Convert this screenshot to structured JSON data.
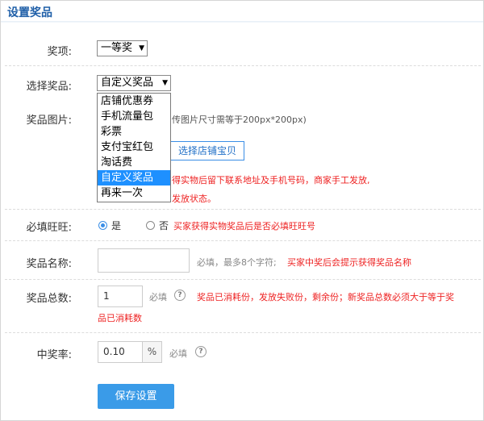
{
  "header": {
    "title": "设置奖品"
  },
  "prize_level": {
    "label": "奖项:",
    "value": "一等奖"
  },
  "prize_type": {
    "label": "选择奖品:",
    "value": "自定义奖品",
    "options": [
      "店铺优惠券",
      "手机流量包",
      "彩票",
      "支付宝红包",
      "淘话费",
      "自定义奖品",
      "再来一次"
    ],
    "selected_index": 5
  },
  "prize_image": {
    "label": "奖品图片:",
    "hint_partial": "传图片尺寸需等于200px*200px)",
    "select_shop_item_button": "选择店铺宝贝",
    "red_note_1": "得实物后留下联系地址及手机号码，商家手工发放,",
    "red_note_2": "发放状态。"
  },
  "wangwang": {
    "label": "必填旺旺:",
    "yes_label": "是",
    "no_label": "否",
    "selected": "是",
    "note": "买家获得实物奖品后是否必填旺旺号"
  },
  "prize_name": {
    "label": "奖品名称:",
    "value": "",
    "hint": "必填，最多8个字符;",
    "note": "买家中奖后会提示获得奖品名称"
  },
  "prize_total": {
    "label": "奖品总数:",
    "value": "1",
    "required": "必填",
    "note_line1": "奖品已消耗份，发放失败份，剩余份；新奖品总数必须大于等于奖",
    "note_line2": "品已消耗数"
  },
  "win_rate": {
    "label": "中奖率:",
    "value": "0.10",
    "unit": "%",
    "required": "必填"
  },
  "save_button": "保存设置",
  "colors": {
    "accent": "#3a9be8",
    "title": "#1f5fa8",
    "warning": "#e22222",
    "dropdown_highlight": "#1e90ff"
  }
}
